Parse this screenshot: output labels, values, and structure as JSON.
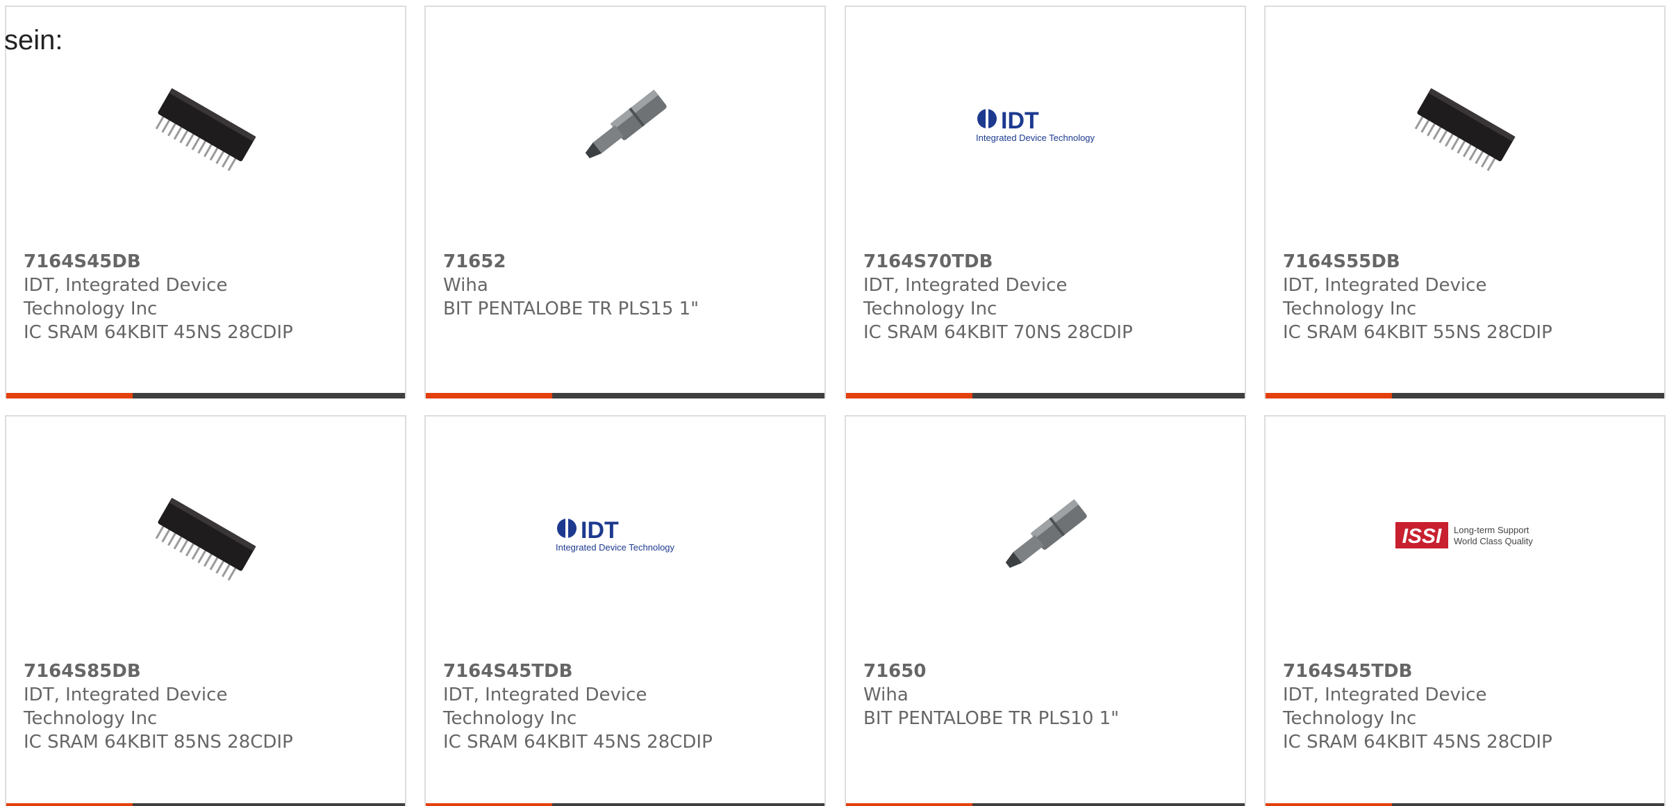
{
  "intro_text": "sein:",
  "colors": {
    "accent": "#e4400e",
    "bar": "#3f3f3f",
    "border": "#dddddd",
    "text": "#666666"
  },
  "products": [
    {
      "part": "7164S45DB",
      "manufacturer": "IDT, Integrated Device Technology Inc",
      "description": "IC SRAM 64KBIT 45NS 28CDIP",
      "image": "dip-chip-image"
    },
    {
      "part": "71652",
      "manufacturer": "Wiha",
      "description": "BIT PENTALOBE TR PLS15 1\"",
      "image": "screwdriver-bit-image"
    },
    {
      "part": "7164S70TDB",
      "manufacturer": "IDT, Integrated Device Technology Inc",
      "description": "IC SRAM 64KBIT 70NS 28CDIP",
      "image": "idt-logo-image"
    },
    {
      "part": "7164S55DB",
      "manufacturer": "IDT, Integrated Device Technology Inc",
      "description": "IC SRAM 64KBIT 55NS 28CDIP",
      "image": "dip-chip-image"
    },
    {
      "part": "7164S85DB",
      "manufacturer": "IDT, Integrated Device Technology Inc",
      "description": "IC SRAM 64KBIT 85NS 28CDIP",
      "image": "dip-chip-image"
    },
    {
      "part": "7164S45TDB",
      "manufacturer": "IDT, Integrated Device Technology Inc",
      "description": "IC SRAM 64KBIT 45NS 28CDIP",
      "image": "idt-logo-image"
    },
    {
      "part": "71650",
      "manufacturer": "Wiha",
      "description": "BIT PENTALOBE TR PLS10 1\"",
      "image": "screwdriver-bit-image"
    },
    {
      "part": "7164S45TDB",
      "manufacturer": "IDT, Integrated Device Technology Inc",
      "description": "IC SRAM 64KBIT 45NS 28CDIP",
      "image": "issi-logo-image"
    }
  ],
  "logos": {
    "idt_name": "IDT",
    "idt_tagline": "Integrated Device Technology",
    "issi_name": "ISSI",
    "issi_tagline_1": "Long-term Support",
    "issi_tagline_2": "World Class Quality"
  }
}
